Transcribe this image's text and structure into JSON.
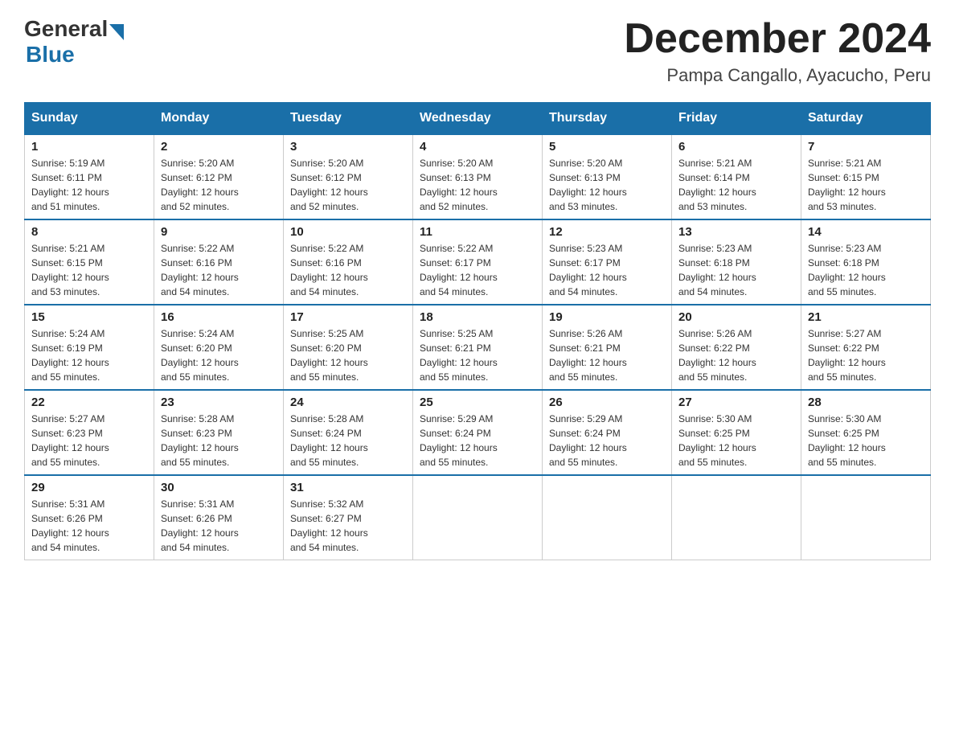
{
  "header": {
    "logo_general": "General",
    "logo_blue": "Blue",
    "month_title": "December 2024",
    "location": "Pampa Cangallo, Ayacucho, Peru"
  },
  "days_of_week": [
    "Sunday",
    "Monday",
    "Tuesday",
    "Wednesday",
    "Thursday",
    "Friday",
    "Saturday"
  ],
  "weeks": [
    [
      {
        "day": "1",
        "sunrise": "5:19 AM",
        "sunset": "6:11 PM",
        "daylight": "12 hours and 51 minutes."
      },
      {
        "day": "2",
        "sunrise": "5:20 AM",
        "sunset": "6:12 PM",
        "daylight": "12 hours and 52 minutes."
      },
      {
        "day": "3",
        "sunrise": "5:20 AM",
        "sunset": "6:12 PM",
        "daylight": "12 hours and 52 minutes."
      },
      {
        "day": "4",
        "sunrise": "5:20 AM",
        "sunset": "6:13 PM",
        "daylight": "12 hours and 52 minutes."
      },
      {
        "day": "5",
        "sunrise": "5:20 AM",
        "sunset": "6:13 PM",
        "daylight": "12 hours and 53 minutes."
      },
      {
        "day": "6",
        "sunrise": "5:21 AM",
        "sunset": "6:14 PM",
        "daylight": "12 hours and 53 minutes."
      },
      {
        "day": "7",
        "sunrise": "5:21 AM",
        "sunset": "6:15 PM",
        "daylight": "12 hours and 53 minutes."
      }
    ],
    [
      {
        "day": "8",
        "sunrise": "5:21 AM",
        "sunset": "6:15 PM",
        "daylight": "12 hours and 53 minutes."
      },
      {
        "day": "9",
        "sunrise": "5:22 AM",
        "sunset": "6:16 PM",
        "daylight": "12 hours and 54 minutes."
      },
      {
        "day": "10",
        "sunrise": "5:22 AM",
        "sunset": "6:16 PM",
        "daylight": "12 hours and 54 minutes."
      },
      {
        "day": "11",
        "sunrise": "5:22 AM",
        "sunset": "6:17 PM",
        "daylight": "12 hours and 54 minutes."
      },
      {
        "day": "12",
        "sunrise": "5:23 AM",
        "sunset": "6:17 PM",
        "daylight": "12 hours and 54 minutes."
      },
      {
        "day": "13",
        "sunrise": "5:23 AM",
        "sunset": "6:18 PM",
        "daylight": "12 hours and 54 minutes."
      },
      {
        "day": "14",
        "sunrise": "5:23 AM",
        "sunset": "6:18 PM",
        "daylight": "12 hours and 55 minutes."
      }
    ],
    [
      {
        "day": "15",
        "sunrise": "5:24 AM",
        "sunset": "6:19 PM",
        "daylight": "12 hours and 55 minutes."
      },
      {
        "day": "16",
        "sunrise": "5:24 AM",
        "sunset": "6:20 PM",
        "daylight": "12 hours and 55 minutes."
      },
      {
        "day": "17",
        "sunrise": "5:25 AM",
        "sunset": "6:20 PM",
        "daylight": "12 hours and 55 minutes."
      },
      {
        "day": "18",
        "sunrise": "5:25 AM",
        "sunset": "6:21 PM",
        "daylight": "12 hours and 55 minutes."
      },
      {
        "day": "19",
        "sunrise": "5:26 AM",
        "sunset": "6:21 PM",
        "daylight": "12 hours and 55 minutes."
      },
      {
        "day": "20",
        "sunrise": "5:26 AM",
        "sunset": "6:22 PM",
        "daylight": "12 hours and 55 minutes."
      },
      {
        "day": "21",
        "sunrise": "5:27 AM",
        "sunset": "6:22 PM",
        "daylight": "12 hours and 55 minutes."
      }
    ],
    [
      {
        "day": "22",
        "sunrise": "5:27 AM",
        "sunset": "6:23 PM",
        "daylight": "12 hours and 55 minutes."
      },
      {
        "day": "23",
        "sunrise": "5:28 AM",
        "sunset": "6:23 PM",
        "daylight": "12 hours and 55 minutes."
      },
      {
        "day": "24",
        "sunrise": "5:28 AM",
        "sunset": "6:24 PM",
        "daylight": "12 hours and 55 minutes."
      },
      {
        "day": "25",
        "sunrise": "5:29 AM",
        "sunset": "6:24 PM",
        "daylight": "12 hours and 55 minutes."
      },
      {
        "day": "26",
        "sunrise": "5:29 AM",
        "sunset": "6:24 PM",
        "daylight": "12 hours and 55 minutes."
      },
      {
        "day": "27",
        "sunrise": "5:30 AM",
        "sunset": "6:25 PM",
        "daylight": "12 hours and 55 minutes."
      },
      {
        "day": "28",
        "sunrise": "5:30 AM",
        "sunset": "6:25 PM",
        "daylight": "12 hours and 55 minutes."
      }
    ],
    [
      {
        "day": "29",
        "sunrise": "5:31 AM",
        "sunset": "6:26 PM",
        "daylight": "12 hours and 54 minutes."
      },
      {
        "day": "30",
        "sunrise": "5:31 AM",
        "sunset": "6:26 PM",
        "daylight": "12 hours and 54 minutes."
      },
      {
        "day": "31",
        "sunrise": "5:32 AM",
        "sunset": "6:27 PM",
        "daylight": "12 hours and 54 minutes."
      },
      null,
      null,
      null,
      null
    ]
  ],
  "labels": {
    "sunrise": "Sunrise:",
    "sunset": "Sunset:",
    "daylight": "Daylight:"
  }
}
